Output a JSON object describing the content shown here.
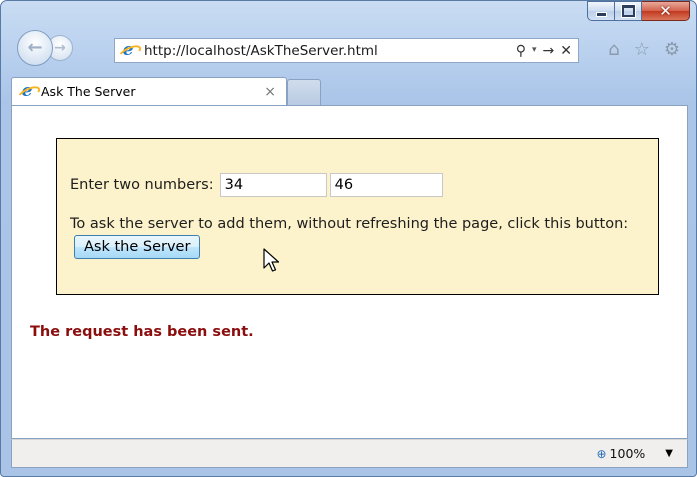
{
  "window": {
    "caption_buttons": {
      "minimize_icon": "minimize-icon",
      "maximize_icon": "maximize-icon",
      "close_icon": "close-icon",
      "close_glyph": "✕"
    }
  },
  "nav": {
    "back_icon": "back-arrow-icon",
    "forward_icon": "forward-arrow-icon",
    "back_glyph": "←",
    "forward_glyph": "→"
  },
  "address_bar": {
    "url": "http://localhost/AskTheServer.html",
    "search_glyph": "⚲",
    "dropdown_glyph": "▾",
    "go_glyph": "→",
    "stop_glyph": "✕"
  },
  "toolbar": {
    "home_glyph": "⌂",
    "favorites_glyph": "☆",
    "tools_glyph": "⚙"
  },
  "tab": {
    "title": "Ask The Server",
    "close_glyph": "×"
  },
  "page": {
    "prompt_label": "Enter two numbers:",
    "number1": "34",
    "number2": "46",
    "instruction": "To ask the server to add them, without refreshing the page, click this button:",
    "button_label": "Ask the Server",
    "status_message": "The request has been sent."
  },
  "status_bar": {
    "zoom_glyph": "⊕",
    "zoom_level": "100%",
    "dropdown_glyph": "▼"
  }
}
